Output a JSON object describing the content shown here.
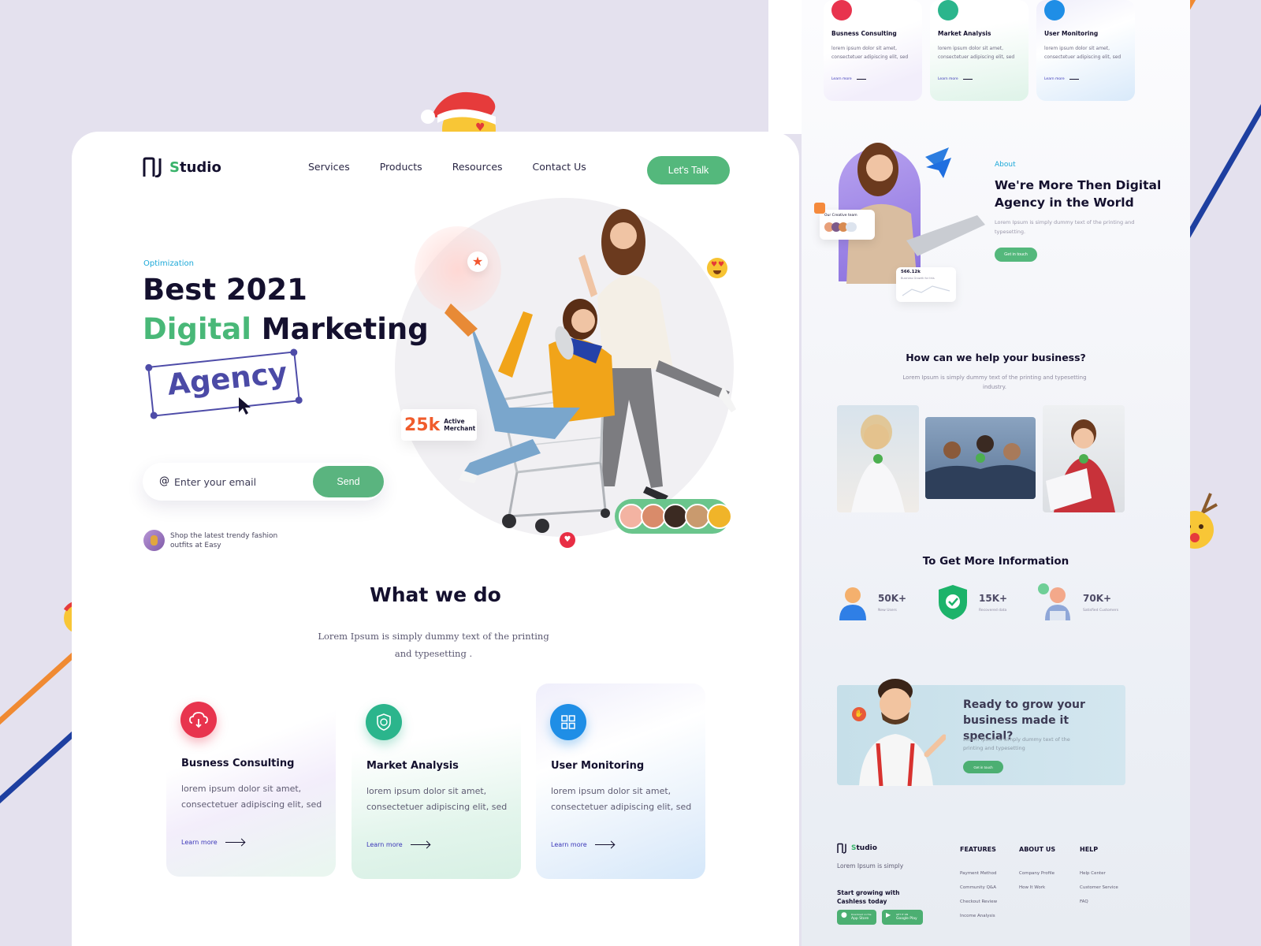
{
  "brand": {
    "logo_mark": "AJ",
    "name_first": "S",
    "name_rest": "tudio"
  },
  "nav": {
    "items": [
      "Services",
      "Products",
      "Resources",
      "Contact Us"
    ],
    "cta": "Let's Talk"
  },
  "hero": {
    "eyebrow": "Optimization",
    "title_line1": "Best 2021",
    "title_green": "Digital",
    "title_dark": "Marketing",
    "highlight": "Agency",
    "email_placeholder": "Enter your email",
    "email_at": "@",
    "send_label": "Send",
    "promo_text": "Shop the latest trendy fashion outfits at Easy",
    "stat_number": "25k",
    "stat_label": "Active Merchant"
  },
  "what_we_do": {
    "title": "What we do",
    "subtitle": "Lorem Ipsum is simply dummy text of the printing and typesetting .",
    "cards": [
      {
        "title": "Busness Consulting",
        "desc": "lorem ipsum dolor sit amet, consectetuer adipiscing elit, sed",
        "link": "Learn more",
        "icon": "cloud-icon",
        "color": "#e8344e"
      },
      {
        "title": "Market Analysis",
        "desc": "lorem ipsum dolor sit amet, consectetuer adipiscing elit, sed",
        "link": "Learn more",
        "icon": "shield-icon",
        "color": "#2bb58c"
      },
      {
        "title": "User Monitoring",
        "desc": "lorem ipsum dolor sit amet, consectetuer adipiscing elit, sed",
        "link": "Learn more",
        "icon": "grid-icon",
        "color": "#1f8ee6"
      }
    ]
  },
  "about": {
    "label": "About",
    "title": "We're More Then Digital Agency in the World",
    "desc": "Lorem Ipsum is simply dummy text of the printing and typesetting.",
    "button": "Get in touch",
    "team_label": "Our Creative team",
    "stat_value": "566.12k",
    "stat_label": "Business Growth for this"
  },
  "help": {
    "title": "How can we help your business?",
    "subtitle": "Lorem Ipsum is simply dummy text of the printing and typesetting industry."
  },
  "info": {
    "title": "To Get More Information",
    "stats": [
      {
        "value": "50K+",
        "label": "New Users"
      },
      {
        "value": "15K+",
        "label": "Recovered data"
      },
      {
        "value": "70K+",
        "label": "Satisfied Customers"
      }
    ]
  },
  "cta": {
    "title": "Ready to grow your business made it special?",
    "desc": "Lorem Ipsum is simply dummy text of the printing and typesetting",
    "button": "Get in touch"
  },
  "footer": {
    "tagline": "Lorem Ipsum is simply",
    "grow": "Start growing with Cashless today",
    "app_store_small": "Download on the",
    "app_store": "App Store",
    "play_small": "GET IT ON",
    "play": "Google Play",
    "columns": [
      {
        "heading": "FEATURES",
        "links": [
          "Payment Method",
          "Community Q&A",
          "Checkout Review",
          "Income Analysis"
        ]
      },
      {
        "heading": "ABOUT US",
        "links": [
          "Company Profile",
          "How It Work"
        ]
      },
      {
        "heading": "HELP",
        "links": [
          "Help Center",
          "Customer Service",
          "FAQ"
        ]
      }
    ]
  },
  "colors": {
    "green": "#54b87c",
    "navy": "#14102e",
    "purple": "#4e4ca8",
    "orange": "#f05c2c",
    "blue": "#1ba8d8"
  }
}
